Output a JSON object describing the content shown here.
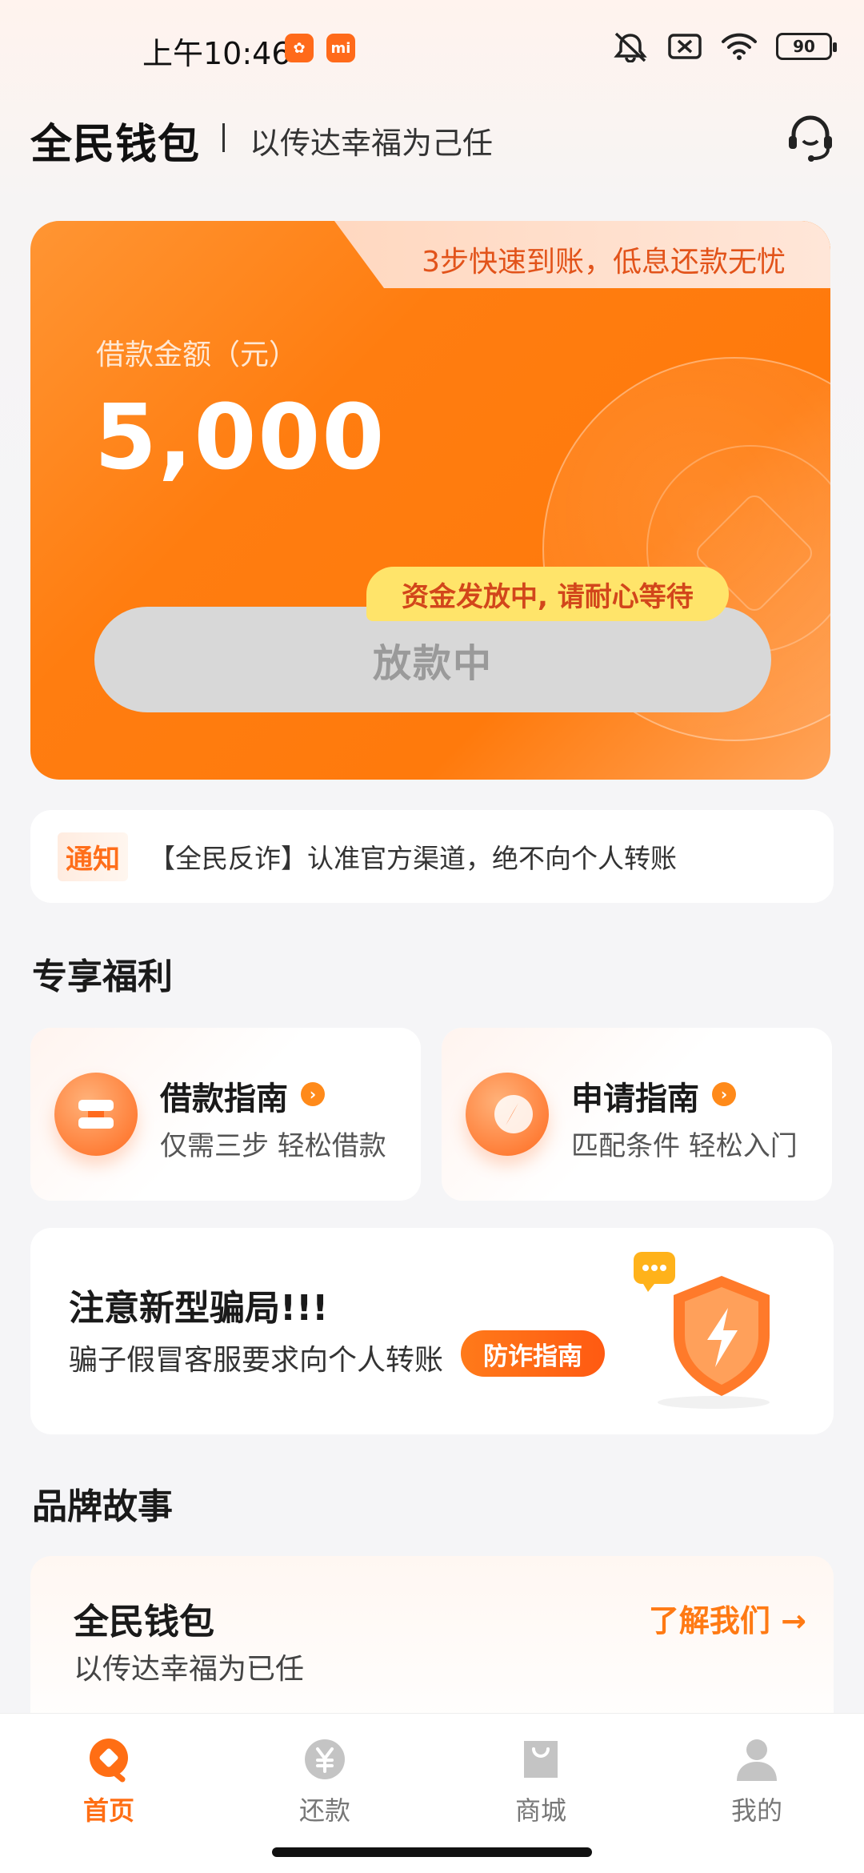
{
  "status_bar": {
    "time": "上午10:46",
    "battery": "90"
  },
  "header": {
    "app_name": "全民钱包",
    "slogan": "以传达幸福为己任"
  },
  "loan_card": {
    "promo_tab": "3步快速到账，低息还款无忧",
    "amount_label": "借款金额（元）",
    "amount": "5,000",
    "status_tip": "资金发放中, 请耐心等待",
    "button_label": "放款中"
  },
  "notice": {
    "tag": "通知",
    "text": "【全民反诈】认准官方渠道，绝不向个人转账"
  },
  "benefits": {
    "section_title": "专享福利",
    "items": [
      {
        "title": "借款指南",
        "subtitle": "仅需三步 轻松借款",
        "icon": "loan-guide-icon"
      },
      {
        "title": "申请指南",
        "subtitle": "匹配条件 轻松入门",
        "icon": "compass-icon"
      }
    ]
  },
  "fraud_alert": {
    "title": "注意新型骗局!!!",
    "subtitle": "骗子假冒客服要求向个人转账",
    "button": "防诈指南"
  },
  "brand": {
    "section_title": "品牌故事",
    "name": "全民钱包",
    "slogan": "以传达幸福为已任",
    "link": "了解我们 →"
  },
  "bottom_nav": {
    "items": [
      {
        "label": "首页",
        "icon": "home-icon",
        "active": true
      },
      {
        "label": "还款",
        "icon": "repay-icon",
        "active": false
      },
      {
        "label": "商城",
        "icon": "shop-bag-icon",
        "active": false
      },
      {
        "label": "我的",
        "icon": "profile-icon",
        "active": false
      }
    ]
  },
  "colors": {
    "accent": "#ff7a14",
    "card_orange": "#ff7d10",
    "tooltip_yellow": "#ffe46a",
    "disabled_button": "#d8d8d8"
  }
}
